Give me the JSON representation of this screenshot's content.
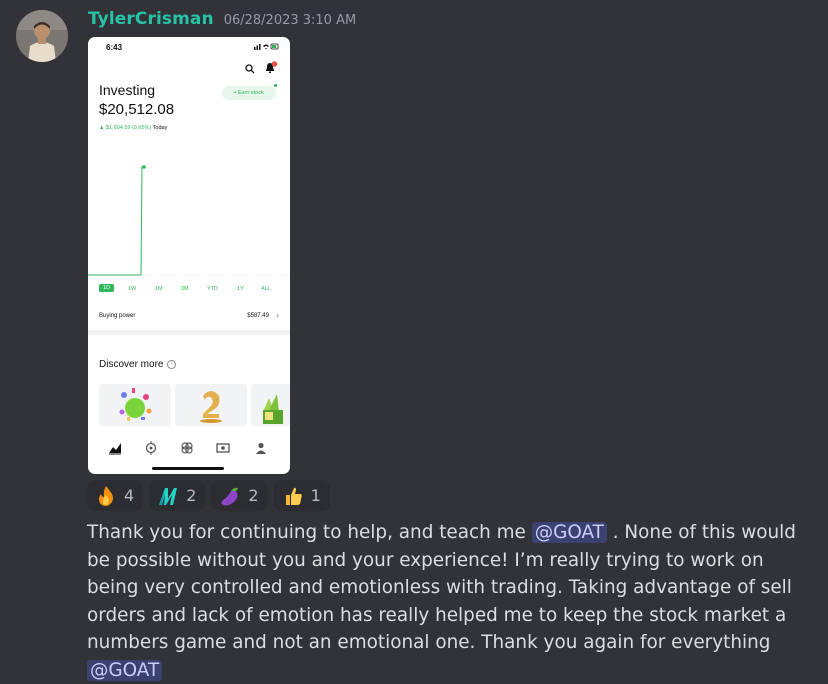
{
  "message": {
    "username": "TylerCrisman",
    "timestamp": "06/28/2023 3:10 AM",
    "text_parts": [
      "Thank you for continuing to help, and teach me ",
      " . None of this would be possible without you and your experience! I’m really trying to work on being very controlled and emotionless with trading. Taking advantage of sell orders and lack of emotion has really helped me to keep the stock market a numbers game and not an emotional one. Thank you again for everything "
    ],
    "mentions": [
      "@GOAT",
      "@GOAT"
    ]
  },
  "reactions": [
    {
      "emoji": "fire-icon",
      "count": "4"
    },
    {
      "emoji": "custom-m-icon",
      "count": "2"
    },
    {
      "emoji": "eggplant-icon",
      "count": "2"
    },
    {
      "emoji": "thumbs-up-icon",
      "count": "1"
    }
  ],
  "screenshot": {
    "status_time": "6:43",
    "title": "Investing",
    "value": "$20,512.08",
    "change": "▲ $1,604.59 (9.65%)",
    "change_period": "Today",
    "earn_label": "Earn stock",
    "ranges": [
      "1D",
      "1W",
      "1M",
      "3M",
      "YTD",
      "1Y",
      "ALL"
    ],
    "selected_range": "1D",
    "buying_power_label": "Buying power",
    "buying_power_value": "$587.49",
    "discover_title": "Discover more",
    "colors": {
      "accent": "#2fb85a",
      "mention_bg": "#3c4270",
      "username": "#26c3a6"
    }
  }
}
